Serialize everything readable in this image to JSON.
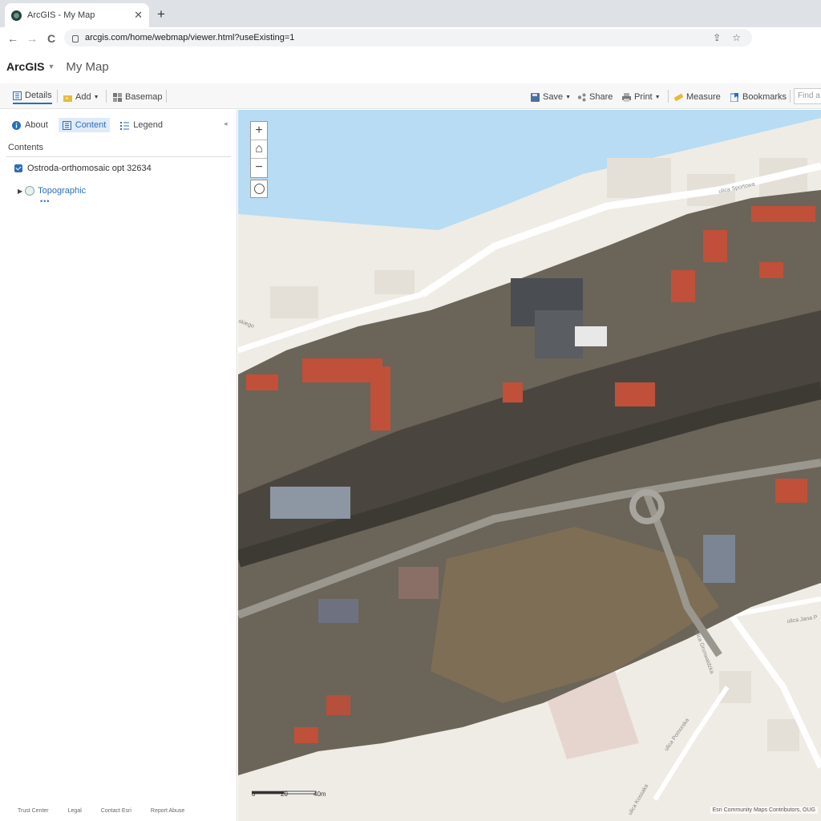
{
  "browser": {
    "tab_title": "ArcGIS - My Map",
    "tab_close": "✕",
    "new_tab": "+",
    "back": "←",
    "forward": "→",
    "reload": "C",
    "url": "arcgis.com/home/webmap/viewer.html?useExisting=1",
    "share_icon": "⇪",
    "star_icon": "☆"
  },
  "app": {
    "brand": "ArcGIS",
    "brand_caret": "▼",
    "map_title": "My Map"
  },
  "toolbar": {
    "details": "Details",
    "add": "Add",
    "basemap": "Basemap",
    "save": "Save",
    "share": "Share",
    "print": "Print",
    "measure": "Measure",
    "bookmarks": "Bookmarks",
    "find_placeholder": "Find a"
  },
  "panel": {
    "tabs": [
      "About",
      "Content",
      "Legend"
    ],
    "active_tab": "Content",
    "collapse_icon": "◂",
    "contents_heading": "Contents",
    "layers": [
      {
        "name": "Ostroda-orthomosaic opt 32634",
        "checked": true
      },
      {
        "name": "Topographic",
        "expand_icon": "▶",
        "dots": "•••"
      }
    ],
    "footer_links": [
      "Trust Center",
      "Legal",
      "Contact Esri",
      "Report Abuse"
    ]
  },
  "map": {
    "zoom_in": "+",
    "home": "⌂",
    "zoom_out": "−",
    "scale_labels": [
      "0",
      "20",
      "40m"
    ],
    "attribution": "Esri Community Maps Contributors, OUG",
    "street_labels": [
      "ulica Sportowa",
      "ulica Jana P",
      "ulica Pomorska",
      "ulica Kossaka",
      "ulica Grunwaldzka",
      "skiego"
    ],
    "colors": {
      "water": "#b7dcf3",
      "land": "#efece5",
      "ortho_dark": "#3d3a34",
      "ortho_mid": "#6b6458",
      "roof_red": "#c0503a"
    }
  }
}
